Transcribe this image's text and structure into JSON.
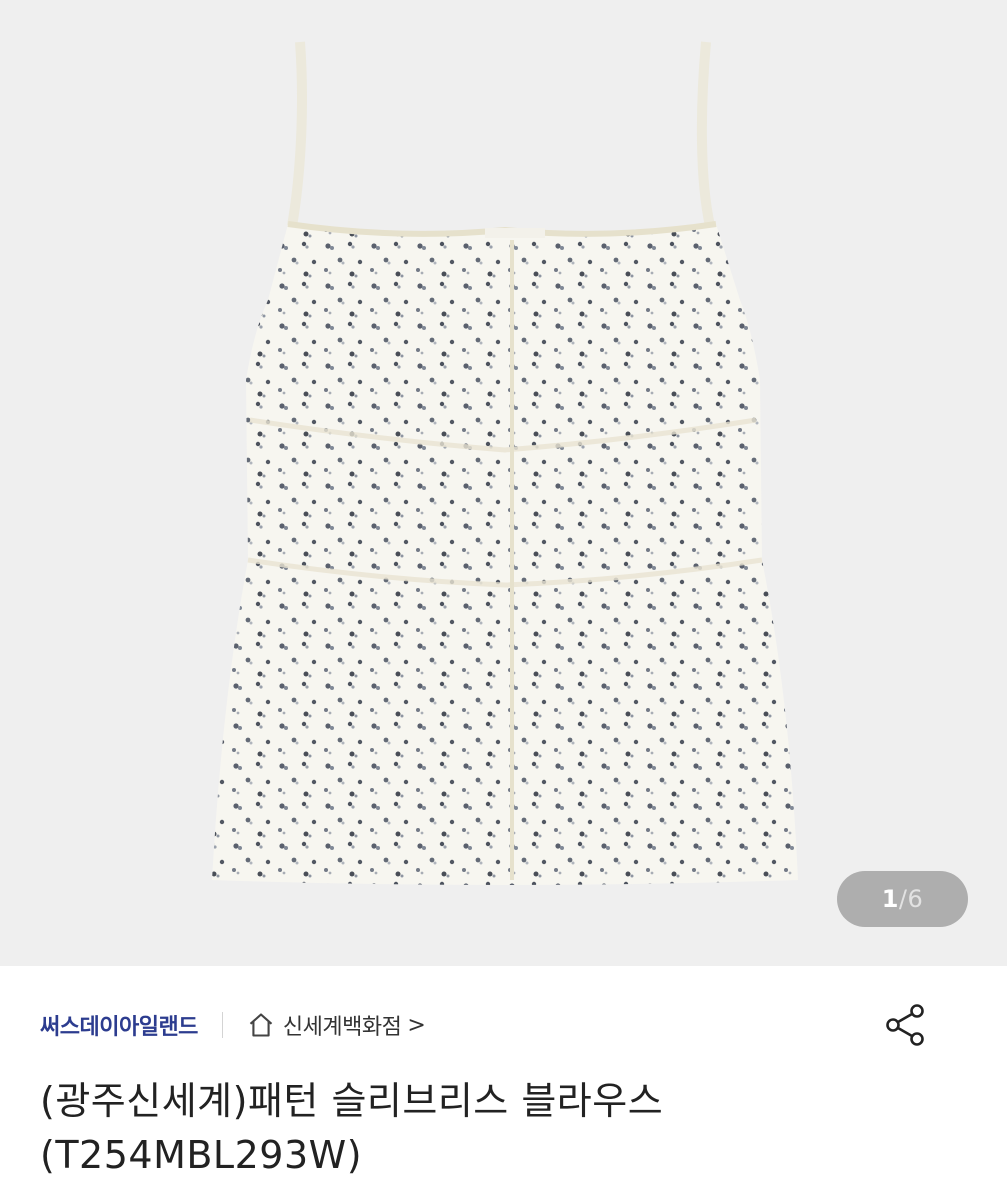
{
  "gallery": {
    "current": "1",
    "separator": "/",
    "total": "6",
    "image_icon": "sleeveless-floral-blouse-image"
  },
  "seller": {
    "brand": "써스데이아일랜드",
    "store_icon": "home-icon",
    "store": "신세계백화점",
    "store_chevron": ">"
  },
  "actions": {
    "share_icon": "share-icon"
  },
  "product": {
    "title_line1": "(광주신세계)패턴 슬리브리스 블라우스",
    "title_line2": "(T254MBL293W)"
  },
  "colors": {
    "hero_bg": "#efefef",
    "brand": "#2c3c8f",
    "counter_bg": "rgba(120,120,120,0.55)"
  }
}
